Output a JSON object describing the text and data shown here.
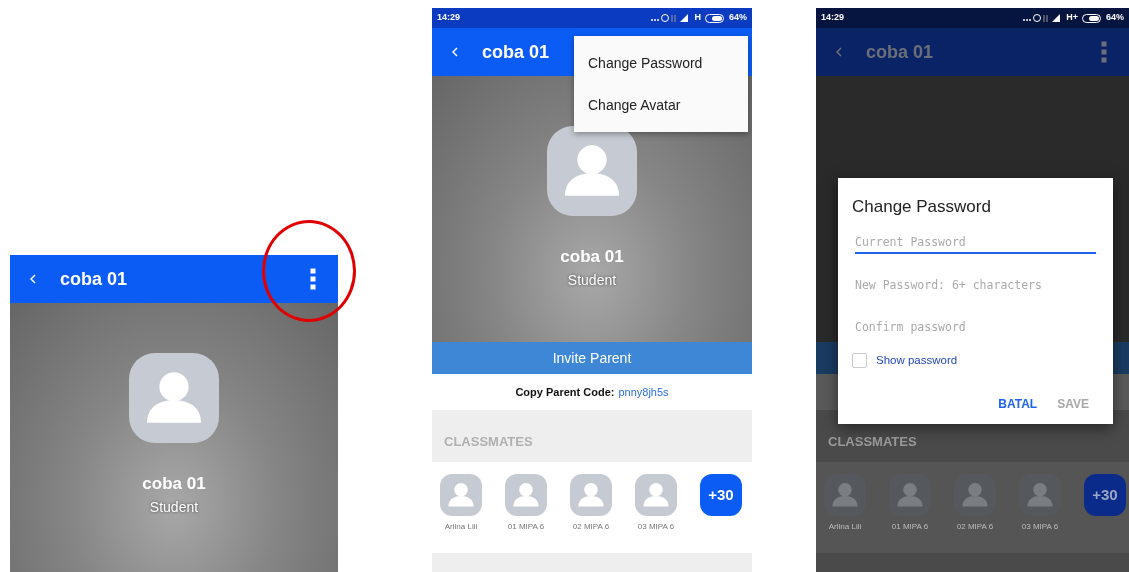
{
  "screens": [
    {
      "kind": "crop",
      "dimmed": false,
      "title": "coba 01",
      "name": "coba 01",
      "role": "Student",
      "menu_circled": true
    },
    {
      "kind": "full",
      "dimmed": false,
      "status": {
        "time": "14:29",
        "network": "H",
        "battery": "64%"
      },
      "title": "coba 01",
      "name": "coba 01",
      "role": "Student",
      "menu": [
        "Change Password",
        "Change Avatar"
      ],
      "invite": "Invite Parent",
      "code_label": "Copy Parent Code:",
      "code": "pnny8jh5s",
      "section": "CLASSMATES",
      "classmates": [
        "Arlina Lili",
        "01 MIPA 6",
        "02 MIPA 6",
        "03 MIPA 6"
      ],
      "more": "+30"
    },
    {
      "kind": "full",
      "dimmed": true,
      "status": {
        "time": "14:29",
        "network": "H+",
        "battery": "64%"
      },
      "title": "coba 01",
      "section": "CLASSMATES",
      "classmates": [
        "Arlina Lili",
        "01 MIPA 6",
        "02 MIPA 6",
        "03 MIPA 6"
      ],
      "more": "+30",
      "dialog": {
        "title": "Change Password",
        "fields": [
          {
            "placeholder": "Current Password",
            "focused": true
          },
          {
            "placeholder": "New Password: 6+ characters",
            "focused": false
          },
          {
            "placeholder": "Confirm password",
            "focused": false
          }
        ],
        "show_password": {
          "label": "Show password",
          "checked": false
        },
        "buttons": [
          {
            "label": "BATAL",
            "disabled": false
          },
          {
            "label": "SAVE",
            "disabled": true
          }
        ]
      }
    }
  ]
}
